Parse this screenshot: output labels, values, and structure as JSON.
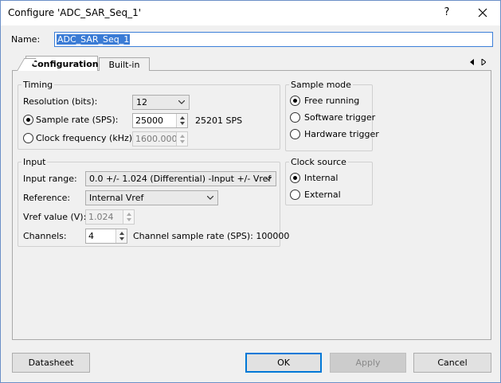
{
  "window": {
    "title": "Configure 'ADC_SAR_Seq_1'",
    "help_glyph": "?",
    "name_label": "Name:",
    "name_value": "ADC_SAR_Seq_1"
  },
  "tabs": [
    {
      "label": "Configuration",
      "active": true
    },
    {
      "label": "Built-in",
      "active": false
    }
  ],
  "timing": {
    "title": "Timing",
    "resolution_label": "Resolution (bits):",
    "resolution_value": "12",
    "sample_rate_label": "Sample rate (SPS):",
    "sample_rate_value": "25000",
    "sample_rate_actual": "25201 SPS",
    "clock_freq_label": "Clock frequency (kHz):",
    "clock_freq_value": "1600.000"
  },
  "sample_mode": {
    "title": "Sample mode",
    "options": [
      {
        "label": "Free running",
        "selected": true
      },
      {
        "label": "Software trigger",
        "selected": false
      },
      {
        "label": "Hardware trigger",
        "selected": false
      }
    ]
  },
  "input": {
    "title": "Input",
    "range_label": "Input range:",
    "range_value": "0.0 +/- 1.024 (Differential) -Input +/- Vref",
    "reference_label": "Reference:",
    "reference_value": "Internal Vref",
    "vref_label": "Vref value (V):",
    "vref_value": "1.024",
    "channels_label": "Channels:",
    "channels_value": "4",
    "channel_rate_text": "Channel sample rate (SPS): 100000"
  },
  "clock_source": {
    "title": "Clock source",
    "options": [
      {
        "label": "Internal",
        "selected": true
      },
      {
        "label": "External",
        "selected": false
      }
    ]
  },
  "buttons": {
    "datasheet": "Datasheet",
    "ok": "OK",
    "apply": "Apply",
    "cancel": "Cancel"
  },
  "colors": {
    "accent": "#0078d7",
    "selection": "#3a7bd5",
    "panel_bg": "#f0f0f0"
  }
}
